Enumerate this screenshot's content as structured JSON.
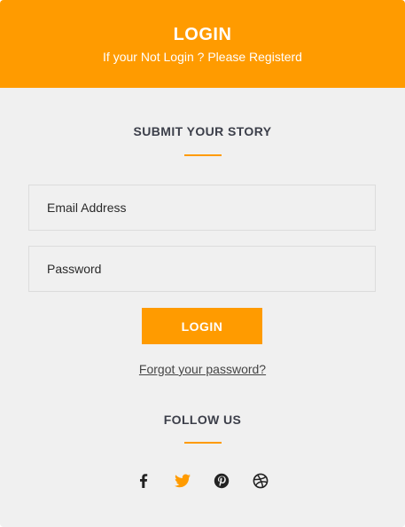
{
  "header": {
    "title": "LOGIN",
    "subtitle": "If your Not Login ? Please Registerd"
  },
  "form": {
    "section_title": "SUBMIT YOUR STORY",
    "email_placeholder": "Email Address",
    "password_placeholder": "Password",
    "login_label": "LOGIN",
    "forgot_link": "Forgot your password?"
  },
  "social": {
    "section_title": "FOLLOW US",
    "icons": [
      "facebook-icon",
      "twitter-icon",
      "pinterest-icon",
      "dribbble-icon"
    ]
  },
  "colors": {
    "accent": "#ff9b00",
    "background": "#f0f0f0",
    "heading": "#3c3f4a"
  }
}
